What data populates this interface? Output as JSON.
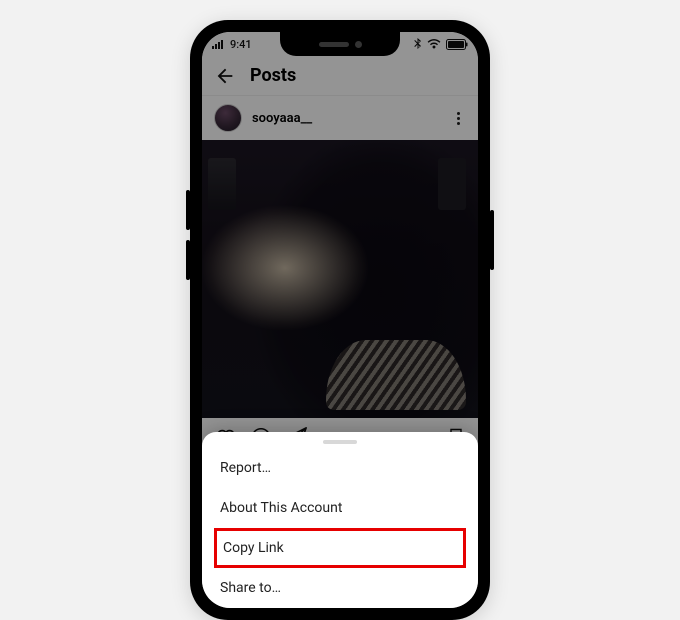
{
  "status": {
    "time": "9:41"
  },
  "header": {
    "title": "Posts"
  },
  "post": {
    "username": "sooyaaa__"
  },
  "sheet": {
    "items": [
      {
        "label": "Report…"
      },
      {
        "label": "About This Account"
      },
      {
        "label": "Copy Link"
      },
      {
        "label": "Share to…"
      }
    ]
  }
}
